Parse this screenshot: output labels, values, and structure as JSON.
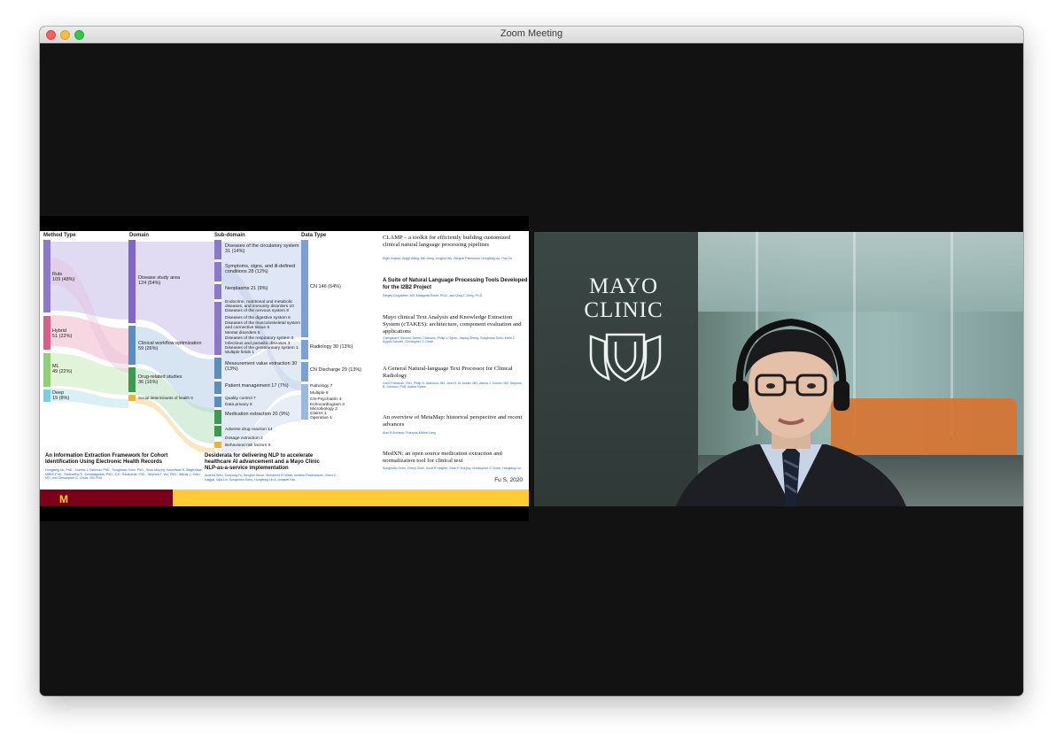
{
  "window": {
    "title": "Zoom Meeting"
  },
  "slide": {
    "columns": [
      "Method Type",
      "Domain",
      "Sub-domain",
      "Data Type"
    ],
    "method_types": [
      {
        "label": "Rule",
        "value": "109 (48%)",
        "color": "#8c7ac8"
      },
      {
        "label": "Hybrid",
        "value": "51 (22%)",
        "color": "#d95f8a"
      },
      {
        "label": "ML",
        "value": "49 (22%)",
        "color": "#8fd07a"
      },
      {
        "label": "Deep",
        "value": "19 (8%)",
        "color": "#77cfe0"
      }
    ],
    "domains": [
      {
        "label": "Disease study area",
        "value": "124 (54%)",
        "color": "#8066c7"
      },
      {
        "label": "Clinical workflow optimization",
        "value": "59 (26%)",
        "color": "#5b8dbf"
      },
      {
        "label": "Drug-related studies",
        "value": "36 (16%)",
        "color": "#3d9a4e"
      },
      {
        "label": "Social determinants of health 9",
        "value": "",
        "color": "#f2b13e"
      }
    ],
    "subdomains": [
      "Diseases of the circulatory system 31 (14%)",
      "Symptoms, signs, and ill-defined conditions 28 (12%)",
      "Neoplasms 21 (9%)",
      "Endocrine, nutritional and metabolic diseases, and immunity disorders 10",
      "Diseases of the nervous system 8",
      "Diseases of the digestive system 6",
      "Diseases of the musculoskeletal system and connective tissue 6",
      "Mental disorders 5",
      "Diseases of the respiratory system 5",
      "Infectious and parasitic diseases 3",
      "Diseases of the genitourinary system 1",
      "Multiple fields 1",
      "Measurement value extraction 30 (13%)",
      "Patient management 17 (7%)",
      "Quality control 7",
      "Data privacy 5",
      "Medication extraction 20 (9%)",
      "Adverse drug reaction 14",
      "Dosage extraction 2",
      "Behavioral risk factors 9"
    ],
    "data_types": [
      "CN 146 (64%)",
      "Radiology 30 (13%)",
      "CN Discharge 29 (13%)",
      "Pathology 7",
      "Multiple 6",
      "CN-Psychiatric 4",
      "Echocardiogram 3",
      "Microbiology 2",
      "Claims 1",
      "Operative 1"
    ],
    "left_paper": {
      "title": "An Information Extraction Framework for Cohort Identification Using Electronic Health Records",
      "authors": "Hongfang Liu, PhD., Suzette J. Bielinski, PhD., Sunghwan Sohn, PhD., Sean Murphy, Kavishwar B. Wagholikar, MBBS PhD., Siddhartha R. Jonnalagadda, PhD., K.E. Ravikumar, PhD., Stephen T. Wu, PhD., Iftikhar J. Kullo, MD, and Christopher G. Chute, MD PhD"
    },
    "mid_paper": {
      "title": "Desiderata for delivering NLP to accelerate healthcare AI advancement and a Mayo Clinic NLP-as-a-service implementation",
      "authors": "Andrew Wen, Sunyang Fu, Sungrim Moon, Mohamed El Wazir, Andrew Rosenbaum, Vinod C. Kaggal, Sijia Liu, Sunghwan Sohn, Hongfang Liu & Jungwei Fan"
    },
    "refs": [
      {
        "title": "CLAMP – a toolkit for efficiently building customized clinical natural language processing pipelines",
        "authors": "Ergin Soysal, Jingqi Wang, Min Jiang, Yonghui Wu, Serguei Pakhomov, Hongfang Liu, Hua Xu"
      },
      {
        "title": "A Suite of Natural Language Processing Tools Developed for the I2B2 Project",
        "authors": "Sergey Goryachev, MS, Margarita Sordo, Ph.D., and Qing T. Zeng, Ph.D."
      },
      {
        "title": "Mayo clinical Text Analysis and Knowledge Extraction System (cTAKES): architecture, component evaluation and applications",
        "authors": "Guergana K Savova, James J Masanz, Philip V Ogren, Jiaping Zheng, Sunghwan Sohn, Karin C Kipper-Schuler, Christopher G Chute"
      },
      {
        "title": "A General Natural-language Text Processor for Clinical Radiology",
        "authors": "Carol Friedman, PhD, Philip O. Alderson, MD, John H. M. Austin, MD, James J. Cimino, MD, Stephen B. Johnson, PhD. Author Notes"
      },
      {
        "title": "An overview of MetaMap: historical perspective and recent advances",
        "authors": "Alan R Aronson, François-Michel Lang"
      },
      {
        "title": "MedXN: an open source medication extraction and normalization tool for clinical text",
        "authors": "Sunghwan Sohn, Cheryl Clark, Scott R Halgrim, Sean P Murphy, Christopher G Chute, Hongfang Liu"
      }
    ],
    "footer_cite": "Fu S, 2020",
    "university_logo": "M"
  },
  "video": {
    "logo_line1": "MAYO",
    "logo_line2": "CLINIC"
  }
}
